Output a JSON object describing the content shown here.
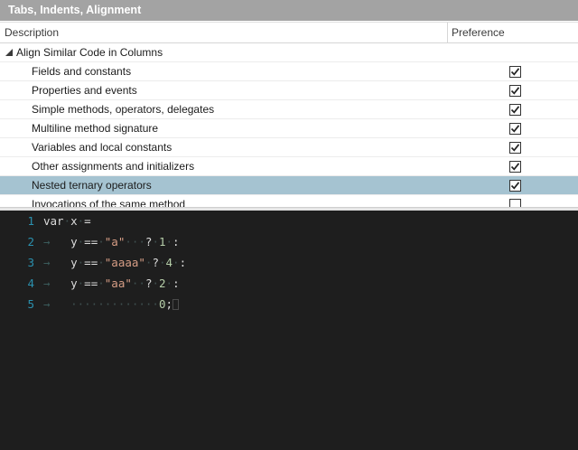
{
  "window": {
    "title": "Tabs, Indents, Alignment"
  },
  "grid": {
    "columns": {
      "description": "Description",
      "preference": "Preference"
    },
    "group": {
      "label": "Align Similar Code in Columns"
    },
    "items": [
      {
        "label": "Fields and constants",
        "checked": true
      },
      {
        "label": "Properties and events",
        "checked": true
      },
      {
        "label": "Simple methods, operators, delegates",
        "checked": true
      },
      {
        "label": "Multiline method signature",
        "checked": true
      },
      {
        "label": "Variables and local constants",
        "checked": true
      },
      {
        "label": "Other assignments and initializers",
        "checked": true
      },
      {
        "label": "Nested ternary operators",
        "checked": true,
        "selected": true
      },
      {
        "label": "Invocations of the same method",
        "checked": false
      }
    ]
  },
  "editor": {
    "line_numbers": [
      "1",
      "2",
      "3",
      "4",
      "5"
    ],
    "lines": {
      "l1": {
        "kw": "var",
        "ident": "x",
        "op": "="
      },
      "l2": {
        "y": "y",
        "eq": "==",
        "str": "\"a\"",
        "q": "?",
        "num": "1",
        "colon": ":"
      },
      "l3": {
        "y": "y",
        "eq": "==",
        "str": "\"aaaa\"",
        "q": "?",
        "num": "4",
        "colon": ":"
      },
      "l4": {
        "y": "y",
        "eq": "==",
        "str": "\"aa\"",
        "q": "?",
        "num": "2",
        "colon": ":"
      },
      "l5": {
        "num": "0",
        "semi": ";"
      }
    },
    "colors": {
      "background": "#1e1e1e",
      "line_number": "#2b91af",
      "string": "#d69d85",
      "number": "#b5cea8"
    }
  }
}
